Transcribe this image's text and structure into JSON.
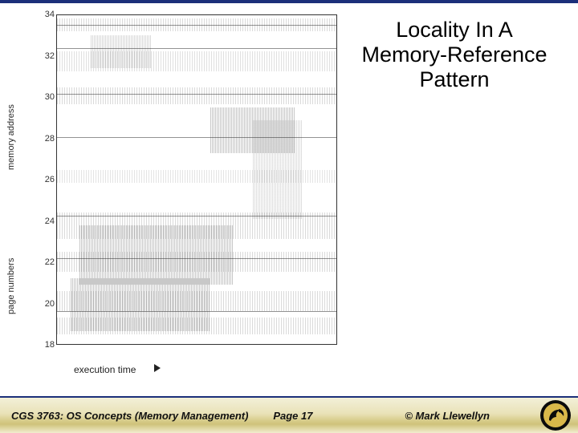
{
  "title": {
    "line1": "Locality In A",
    "line2": "Memory-Reference",
    "line3": "Pattern"
  },
  "figure": {
    "ylabel_upper": "memory address",
    "ylabel_lower": "page numbers",
    "xlabel": "execution time",
    "yticks": [
      "18",
      "20",
      "22",
      "24",
      "26",
      "28",
      "30",
      "32",
      "34"
    ]
  },
  "footer": {
    "course": "CGS 3763: OS Concepts (Memory Management)",
    "page": "Page 17",
    "copyright": "© Mark Llewellyn"
  },
  "chart_data": {
    "type": "scatter",
    "title": "Locality In A Memory-Reference Pattern",
    "xlabel": "execution time",
    "ylabel": "page numbers / memory address",
    "ylim": [
      18,
      34
    ],
    "note": "Qualitative trace: dense horizontal bands of page references over execution time showing locality clusters. Exact x values not labeled.",
    "yticks": [
      18,
      20,
      22,
      24,
      26,
      28,
      30,
      32,
      34
    ],
    "locality_bands_approx_page": [
      18,
      19,
      20,
      21,
      22,
      23,
      24,
      26,
      28,
      30,
      31,
      32,
      33,
      34
    ]
  }
}
